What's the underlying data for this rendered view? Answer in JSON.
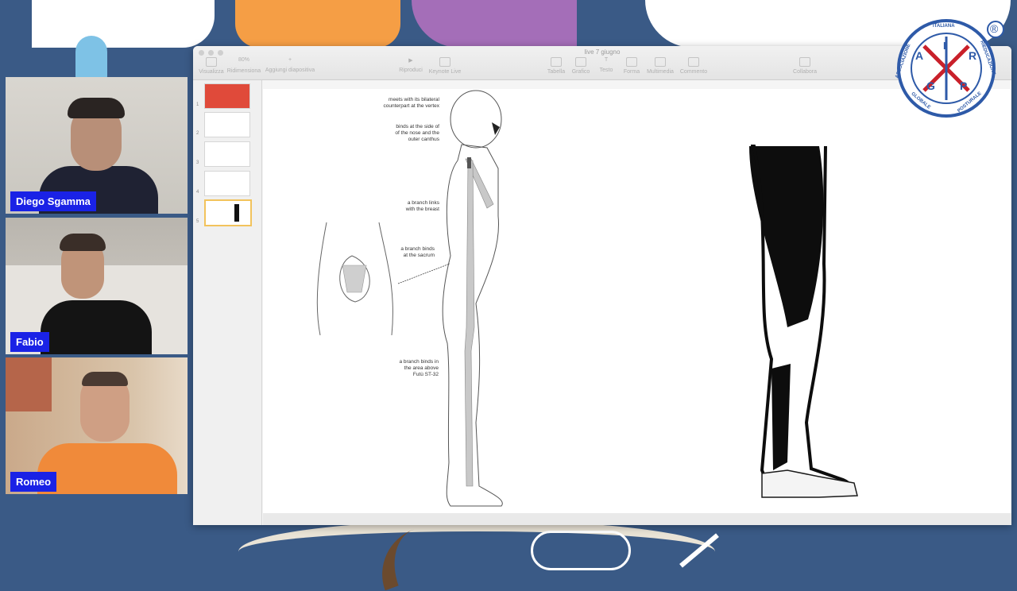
{
  "presentation": {
    "doc_title": "live 7 giugno",
    "zoom": "80%",
    "toolbar_left": [
      {
        "label": "Visualizza",
        "icon": "sidebar-icon"
      },
      {
        "label": "Ridimensiona",
        "icon": "zoom-icon"
      },
      {
        "label": "Aggiungi diapositiva",
        "icon": "add-slide-icon"
      }
    ],
    "toolbar_center": [
      {
        "label": "Riproduci",
        "icon": "play-icon"
      },
      {
        "label": "Keynote Live",
        "icon": "keynote-live-icon"
      }
    ],
    "toolbar_right": [
      {
        "label": "Tabella",
        "icon": "table-icon"
      },
      {
        "label": "Grafico",
        "icon": "chart-icon"
      },
      {
        "label": "Testo",
        "icon": "text-icon"
      },
      {
        "label": "Forma",
        "icon": "shape-icon"
      },
      {
        "label": "Multimedia",
        "icon": "media-icon"
      },
      {
        "label": "Commento",
        "icon": "comment-icon"
      },
      {
        "label": "Collabora",
        "icon": "collaborate-icon"
      }
    ],
    "slides": [
      {
        "num": "1"
      },
      {
        "num": "2"
      },
      {
        "num": "3"
      },
      {
        "num": "4"
      },
      {
        "num": "5"
      }
    ],
    "annotations": {
      "a1": "meets with its bilateral\ncounterpart at the vertex",
      "a2": "binds at the side of\nof the nose and the\nouter canthus",
      "a3": "a branch links\nwith the breast",
      "a4": "a branch binds\nat the sacrum",
      "a5": "a branch binds in\nthe area above\nFutù ST-32"
    }
  },
  "participants": [
    {
      "name": "Diego Sgamma"
    },
    {
      "name": "Fabio"
    },
    {
      "name": "Romeo"
    }
  ],
  "logo": {
    "letters": [
      "A",
      "I",
      "R",
      "G",
      "P"
    ],
    "registered": "®",
    "ring_text_left": "ASSOCIAZIONE",
    "ring_text_top": "ITALIANA",
    "ring_text_right": "RIEDUCAZIONE",
    "ring_text_bottom_left": "GLOBALE",
    "ring_text_bottom_right": "POSTURALE"
  },
  "colors": {
    "background": "#3a5a86",
    "name_tag": "#1a22e6",
    "logo_accent": "#c9202a",
    "logo_blue": "#2e5aa8",
    "selected_slide": "#f2c35c"
  }
}
